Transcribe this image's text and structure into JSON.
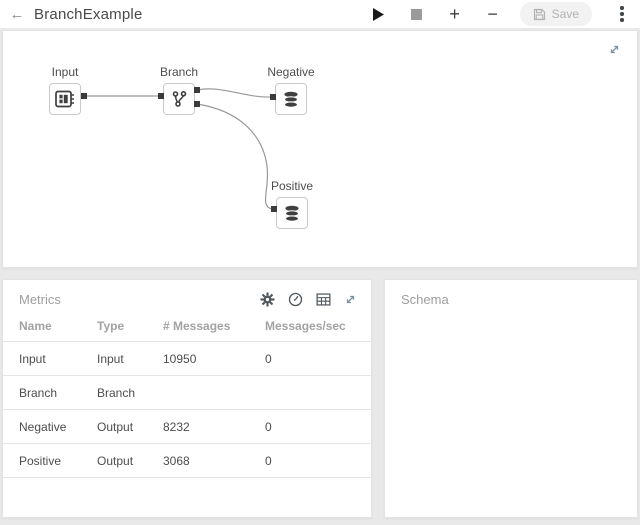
{
  "colors": {
    "page_bg": "#e9e9e9",
    "panel_bg": "#ffffff",
    "text_dark": "#4d4d4d",
    "text_muted": "#9e9e9e",
    "icon_dark": "#4d545a",
    "expand_icon": "#7d8fa3",
    "node_border": "#c9c9c9",
    "edge": "#999999",
    "port": "#3b3b3b",
    "play": "#1a1a1a",
    "stop": "#9b9b9b",
    "save_bg": "#f2f2f2",
    "save_text": "#b3b3b3"
  },
  "header": {
    "back_glyph": "←",
    "title": "BranchExample",
    "zoom_in_glyph": "+",
    "zoom_out_glyph": "−",
    "save_label": "Save",
    "icons": [
      "back-icon",
      "play-icon",
      "stop-icon",
      "plus-icon",
      "minus-icon",
      "save-icon",
      "kebab-menu-icon"
    ]
  },
  "canvas": {
    "expand_icon": "expand-diagonal-icon",
    "nodes": [
      {
        "label": "Input",
        "icon": "input-window-icon"
      },
      {
        "label": "Branch",
        "icon": "branch-icon"
      },
      {
        "label": "Negative",
        "icon": "database-icon"
      },
      {
        "label": "Positive",
        "icon": "database-icon"
      }
    ],
    "edges": [
      {
        "from": "Input",
        "to": "Branch"
      },
      {
        "from": "Branch",
        "to": "Negative"
      },
      {
        "from": "Branch",
        "to": "Positive"
      }
    ]
  },
  "metrics": {
    "title": "Metrics",
    "icons": [
      "gear-icon",
      "clock-icon",
      "table-icon",
      "expand-diagonal-icon"
    ],
    "columns": [
      "Name",
      "Type",
      "# Messages",
      "Messages/sec"
    ],
    "rows": [
      {
        "name": "Input",
        "type": "Input",
        "messages": "10950",
        "rate": "0"
      },
      {
        "name": "Branch",
        "type": "Branch",
        "messages": "",
        "rate": ""
      },
      {
        "name": "Negative",
        "type": "Output",
        "messages": "8232",
        "rate": "0"
      },
      {
        "name": "Positive",
        "type": "Output",
        "messages": "3068",
        "rate": "0"
      }
    ]
  },
  "schema": {
    "title": "Schema"
  }
}
